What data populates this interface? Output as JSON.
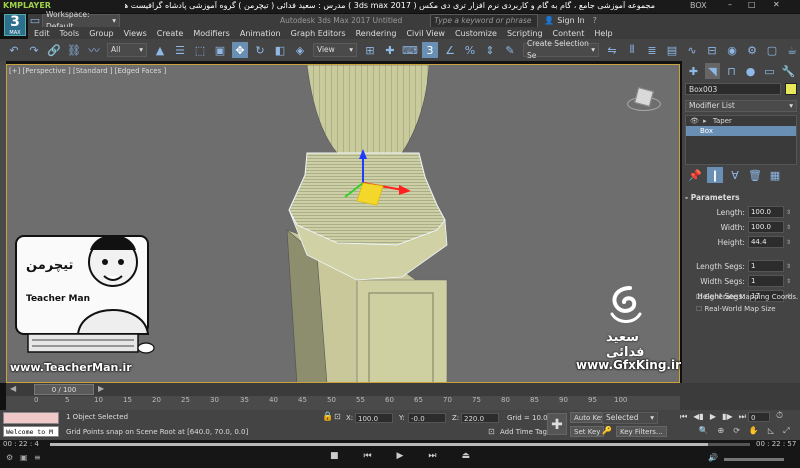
{
  "player": {
    "logo": "KMPLAYER",
    "title": "مجموعه آموزشی جامع ، گام به گام و کاربردی نرم افزار تری دی مکس ( 3ds max 2017 ) مدرس : سعید فدائی ( تیچرمن ) گروه آموزشی پادشاه گرافیست ها",
    "right_label": "BOX",
    "elapsed": "00 : 22 : 4",
    "remaining": "00 : 22 : 57",
    "progress": 0.94
  },
  "app": {
    "logo_text": "3",
    "logo_sub": "MAX",
    "workspace": "Workspace: Default",
    "title": "Autodesk 3ds Max 2017    Untitled",
    "search_placeholder": "Type a keyword or phrase",
    "sign_in": "Sign In",
    "menu": [
      "Edit",
      "Tools",
      "Group",
      "Views",
      "Create",
      "Modifiers",
      "Animation",
      "Graph Editors",
      "Rendering",
      "Civil View",
      "Customize",
      "Scripting",
      "Content",
      "Help"
    ],
    "filter_all": "All",
    "view_dd": "View",
    "selection_set": "Create Selection Se"
  },
  "viewport": {
    "label": "[+] [Perspective ] [Standard ] [Edged Faces ]"
  },
  "panel": {
    "object_name": "Box003",
    "object_color": "#e8e85a",
    "modifier_list": "Modifier List",
    "stack": [
      "Taper",
      "Box"
    ],
    "parameters_title": "Parameters",
    "params": [
      {
        "label": "Length:",
        "value": "100.0"
      },
      {
        "label": "Width:",
        "value": "100.0"
      },
      {
        "label": "Height:",
        "value": "44.4"
      }
    ],
    "segs": [
      {
        "label": "Length Segs:",
        "value": "1"
      },
      {
        "label": "Width Segs:",
        "value": "1"
      },
      {
        "label": "Height Segs:",
        "value": "17"
      }
    ],
    "generate_mapping": "Generate Mapping Coords.",
    "real_world": "Real-World Map Size"
  },
  "watermark": {
    "teacher_fa": "تیچرمن",
    "teacher_en": "Teacher Man",
    "teacher_url": "www.TeacherMan.ir",
    "gfx_name": "سعید فدائی",
    "gfx_url": "www.GfxKing.ir"
  },
  "timeline": {
    "frame": "0 / 100",
    "ticks": [
      "0",
      "5",
      "10",
      "15",
      "20",
      "25",
      "30",
      "35",
      "40",
      "45",
      "50",
      "55",
      "60",
      "65",
      "70",
      "75",
      "80",
      "85",
      "90",
      "95",
      "100"
    ]
  },
  "status": {
    "welcome": "Welcome to M",
    "selected": "1 Object Selected",
    "prompt": "Grid Points snap on Scene Root at [640.0, 70.0, 0.0]",
    "x_label": "X:",
    "x": "100.0",
    "y_label": "Y:",
    "y": "-0.0",
    "z_label": "Z:",
    "z": "220.0",
    "grid": "Grid = 10.0",
    "add_time_tag": "Add Time Tag",
    "auto_key": "Auto Key",
    "set_key": "Set Key",
    "selected_dd": "Selected",
    "key_filters": "Key Filters...",
    "frame_field": "0"
  }
}
